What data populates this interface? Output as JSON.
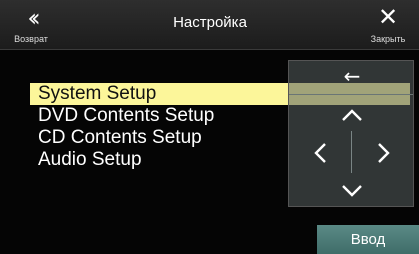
{
  "header": {
    "back_label": "Возврат",
    "back_icon": "double-chevron-left-icon",
    "title": "Настройка",
    "close_label": "Закрыть",
    "close_icon": "close-icon"
  },
  "menu": {
    "items": [
      {
        "label": "System Setup",
        "selected": true
      },
      {
        "label": "DVD Contents Setup",
        "selected": false
      },
      {
        "label": "CD Contents Setup",
        "selected": false
      },
      {
        "label": "Audio Setup",
        "selected": false
      }
    ]
  },
  "nav_pad": {
    "back_icon": "arrow-left-icon",
    "up_icon": "chevron-up-icon",
    "left_icon": "chevron-left-icon",
    "right_icon": "chevron-right-icon",
    "down_icon": "chevron-down-icon"
  },
  "enter_label": "Ввод",
  "colors": {
    "selected_highlight": "#fcf69a",
    "enter_button": "#4e7e7a",
    "header": "#262626"
  }
}
